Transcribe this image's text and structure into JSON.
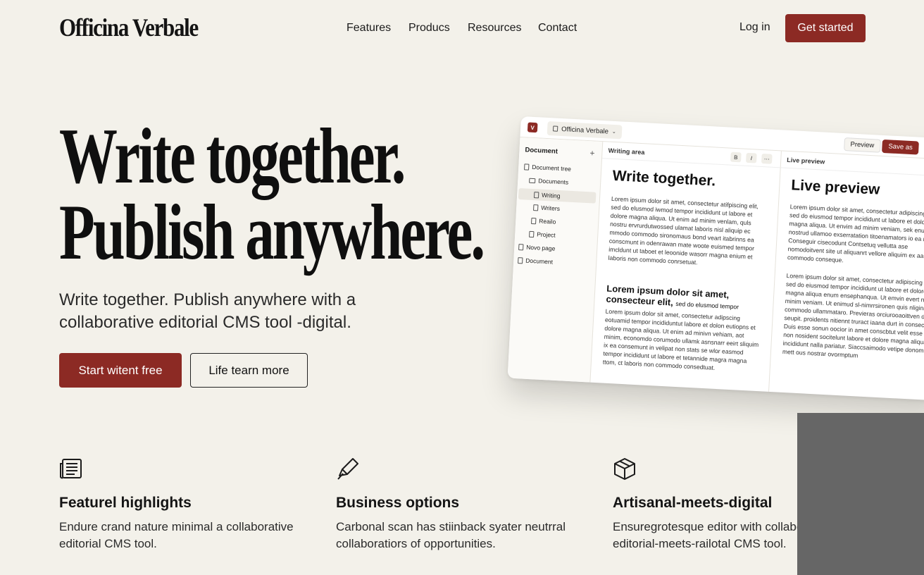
{
  "nav": {
    "brand": "Officina Verbale",
    "links": [
      "Features",
      "Producs",
      "Resources",
      "Contact"
    ],
    "login": "Log in",
    "cta": "Get started"
  },
  "hero": {
    "title_line1": "Write together.",
    "title_line2": "Publish anywhere.",
    "subtitle": "Write together. Publish anywhere with a collaborative editorial CMS tool -digital.",
    "primary_button": "Start witent free",
    "secondary_button": "Life tearn more"
  },
  "mockup": {
    "logo": "V",
    "crumb": "Officina Verbale",
    "preview_button": "Preview",
    "save_button": "Save as",
    "sidebar": {
      "title": "Document",
      "plus": "+",
      "items": [
        "Document tree",
        "Documents",
        "Writing",
        "Writers",
        "Reailo",
        "Project",
        "Novo page",
        "Document"
      ]
    },
    "writing": {
      "label": "Writing area",
      "format": [
        "B",
        "I",
        "⋯"
      ],
      "heading": "Write together.",
      "para1": "Lorem ipsum dolor sit amet, consectetur atifpiscing elit, sed do elusmod iwmod tempor incididunt ut labore et dolore magna aliqua. Ut enim ad minim venlam, quls nostru ervrurdutwossed ulamat laboris nisl aliquip ec mmodo commodo sironomaus bond veart itabrinns ea conscmunt in odenrawan mate woote euismed tempor imcldunt ut taboet et leoonide wasorr magna enium et laboris non commodo conrsetuat.",
      "subheading": "Lorem ipsum dolor sit amet, consecteur elit,",
      "subheading_tail": "sed do elusmod tempor",
      "para2": "Lorem ipsum dolor sit amet, consectetur adipscing eotuamid tempor incididuntut labore et dolon eutiopns et dolore magna aliqua. Ut enim ad minivn vehiam, aot minim, economdo corumodo ullamk asnsnarr eeirt sliquim ix ea consemunt in velipat non stats se wlor easmod tempor incididunt ut labore et tetannide magra magna ttom, ct laboris non commodo consedtuat."
    },
    "preview": {
      "label": "Live preview",
      "heading": "Live preview",
      "para1": "Lorem ipsum dolor sit amet, consectetur adipiscing elit, sed do eiusmod tempor incididunt ut labore et dolore magna aliqua. Ut envim ad minim veniam, sek enum nostrud ullamoo exserratation titoenamators io ea megus. Conseguir cisecodunt Contsetuq vellutta ase nomodoitvent site ut aliquanrt vellore aliquim ex aa commodo conseque.",
      "para2": "Lorem ipsum dolor sit amet, consectetur adipiscing elit, sed do eiusmod tempor incididunt ut labore et dolore magna aliqua enum ensephanqua. Ut emvin evert nostrud minim veniam. Ut enimud sl-nimrrsironen quis nliginr ex commodo ullammataro. Previeras orciurooaoittven dil et seupit. proidents nitiennt truract iaana durt in consecteur. Duis esse sonun oocior in amet conscbtut velit esse dutot non nosident socitelunt labore et dolore magna aliqua incididunt nalla pariatur. Siaccsaimodo vetipe donom sit mett ous nostrar ovormptum"
    }
  },
  "features": [
    {
      "icon": "newspaper-icon",
      "title": "Featurel highlights",
      "desc": "Endure crand nature minimal a collaborative editorial CMS tool."
    },
    {
      "icon": "pen-nib-icon",
      "title": "Business options",
      "desc": "Carbonal scan has stiinback syater neutrral collaboratiors of opportunities."
    },
    {
      "icon": "box-icon",
      "title": "Artisanal-meets-digital",
      "desc": "Ensuregrotesque editor with collaborative editorial-meets-railotal CMS tool."
    }
  ],
  "colors": {
    "accent": "#8c2a24",
    "background": "#f3f1ea"
  }
}
